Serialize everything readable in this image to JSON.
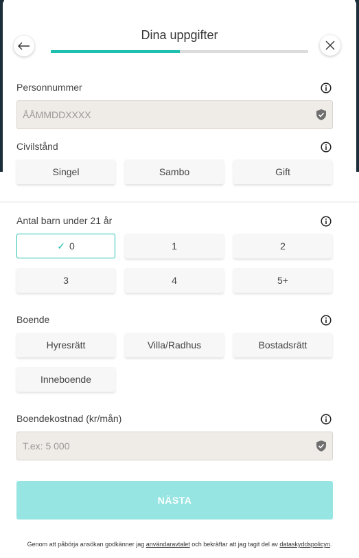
{
  "header": {
    "title": "Dina uppgifter",
    "progress_fraction": 0.5
  },
  "personnummer": {
    "label": "Personnummer",
    "placeholder": "ÅÅMMDDXXXX"
  },
  "civilstand": {
    "label": "Civilstånd",
    "options": [
      "Singel",
      "Sambo",
      "Gift"
    ]
  },
  "barn": {
    "label": "Antal barn under 21 år",
    "options": [
      "0",
      "1",
      "2",
      "3",
      "4",
      "5+"
    ],
    "selected": "0"
  },
  "boende": {
    "label": "Boende",
    "options": [
      "Hyresrätt",
      "Villa/Radhus",
      "Bostadsrätt",
      "Inneboende"
    ]
  },
  "boendekostnad": {
    "label": "Boendekostnad (kr/mån)",
    "placeholder": "T.ex: 5 000"
  },
  "next_label": "NÄSTA",
  "footer": {
    "text1": "Genom att påbörja ansökan godkänner jag ",
    "link1": "användaravtalet",
    "text2": " och bekräftar att jag tagit del av ",
    "link2": "dataskyddspolicyn",
    "text3": "."
  },
  "colors": {
    "accent": "#1fbfb0",
    "button_disabled": "#96e5e2",
    "input_bg": "#efebe6",
    "backdrop": "#1c2e3a"
  },
  "icons": [
    "arrow-left-icon",
    "close-icon",
    "info-icon",
    "shield-check-icon",
    "check-icon"
  ]
}
